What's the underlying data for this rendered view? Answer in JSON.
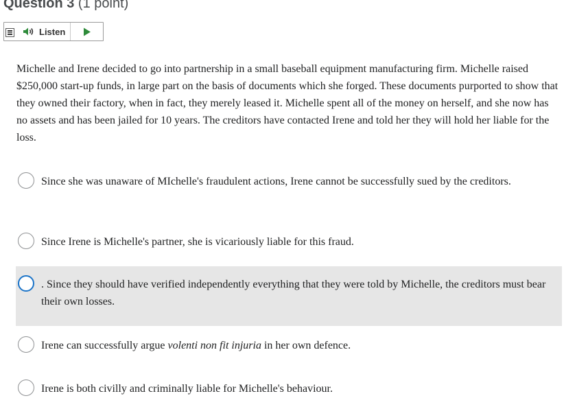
{
  "question": {
    "title": "Question 3",
    "points": "(1 point)",
    "body": "Michelle and Irene decided to go into partnership in a small baseball equipment manufacturing firm. Michelle raised $250,000 start-up funds, in large part on the basis of documents which she forged. These documents purported to show that they owned their factory, when in fact, they merely leased it. Michelle spent all of the money on herself, and she now has no assets and has been jailed for 10 years. The creditors have contacted Irene and told her they will hold her liable for the loss."
  },
  "toolbar": {
    "listen_label": "Listen",
    "menu_icon": "menu-icon",
    "speaker_icon": "speaker-icon",
    "play_icon": "play-icon",
    "accent_color": "#2e8b3a"
  },
  "options": [
    {
      "text": "Since she was unaware of MIchelle's fraudulent actions, Irene cannot be successfully sued by the creditors."
    },
    {
      "text": "Since Irene is Michelle's partner, she is vicariously liable for this fraud."
    },
    {
      "text": ". Since they should have verified independently everything that they were told by Michelle, the creditors must bear their own losses.",
      "highlighted": true
    },
    {
      "text_before": "Irene can successfully argue ",
      "text_italic": "volenti non fit injuria",
      "text_after": " in her own defence."
    },
    {
      "text": "Irene is both civilly and criminally liable for Michelle's behaviour."
    }
  ],
  "colors": {
    "highlight_bg": "#e6e6e6",
    "focus_ring": "#1a73c8",
    "radio_border": "#8d8f91"
  }
}
